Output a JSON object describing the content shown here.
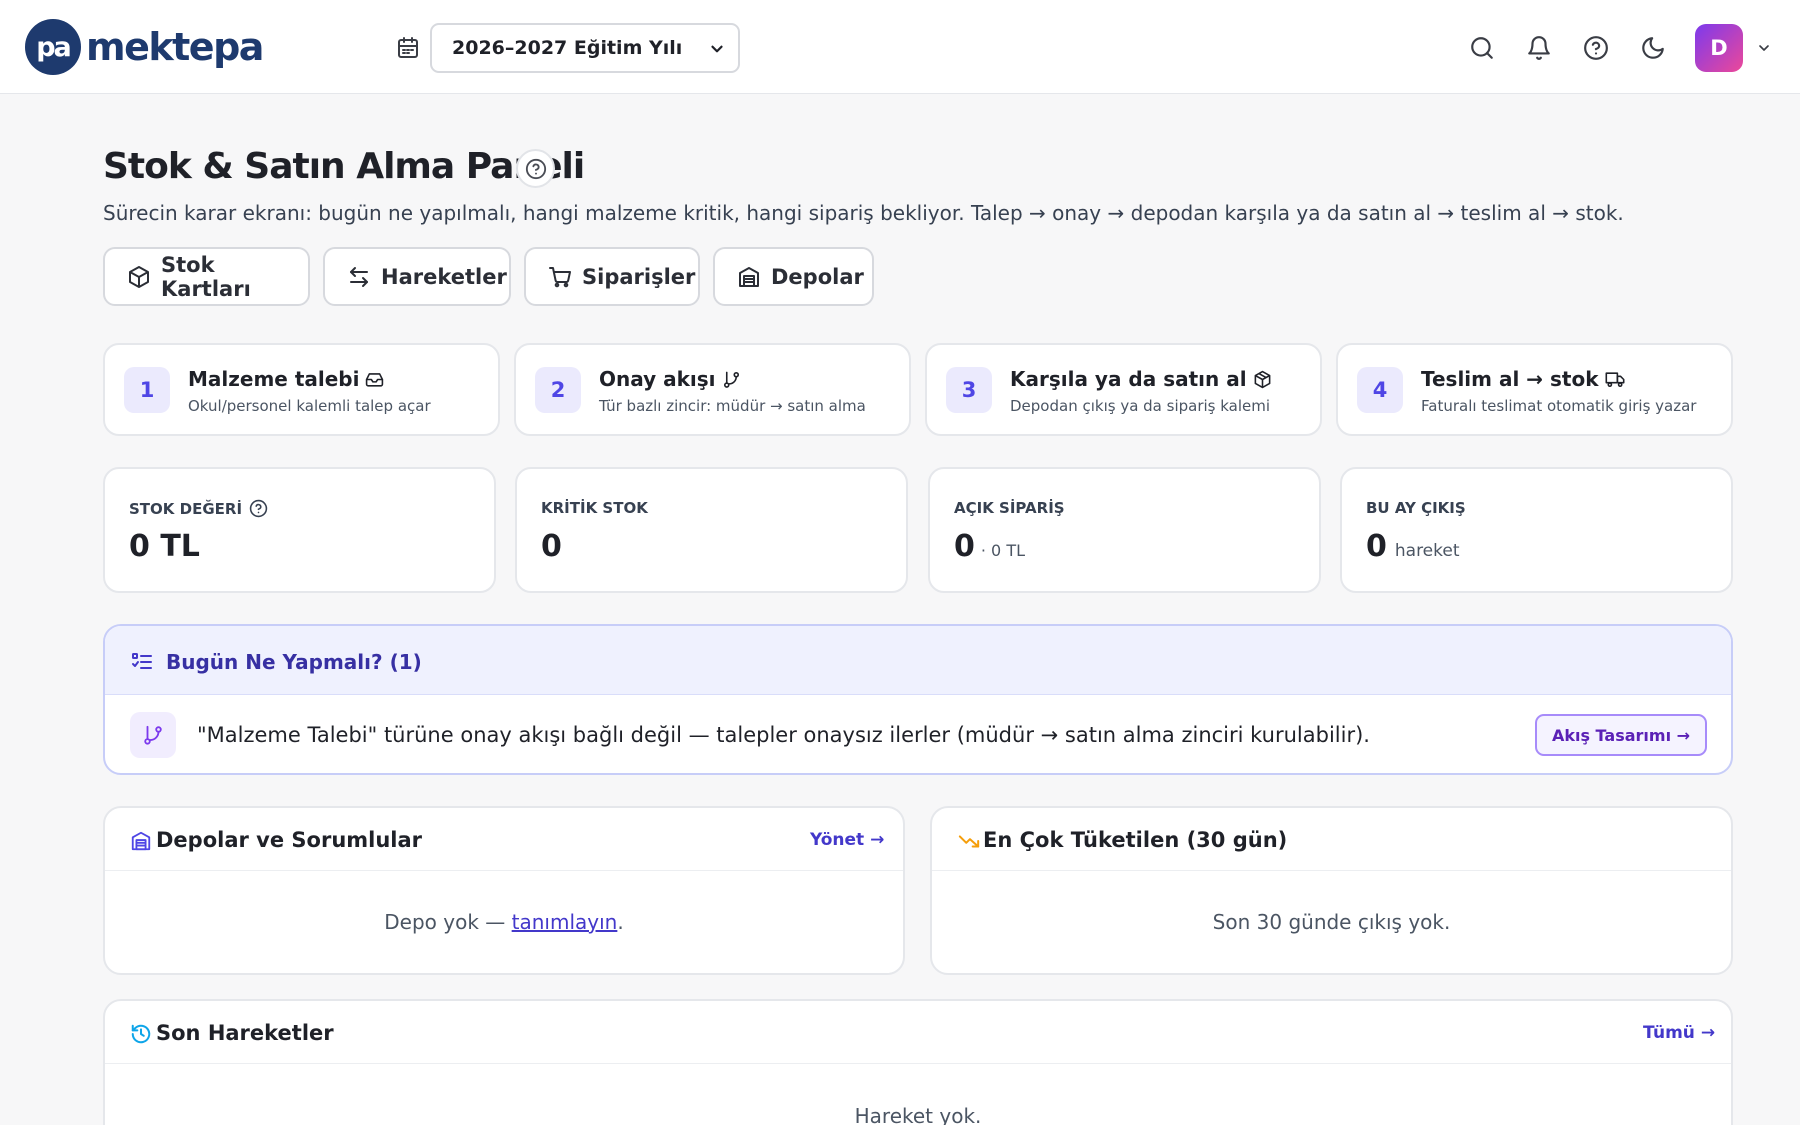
{
  "topbar": {
    "logo_mark": "pa",
    "logo_text": "mektepa",
    "year_select_value": "2026–2027 Eğitim Yılı",
    "avatar_initial": "D",
    "icons": [
      "calendar-icon",
      "search-icon",
      "bell-icon",
      "help-icon",
      "moon-icon",
      "chevron-down-icon"
    ]
  },
  "page": {
    "title": "Stok & Satın Alma Paneli",
    "subtitle": "Sürecin karar ekranı: bugün ne yapılmalı, hangi malzeme kritik, hangi sipariş bekliyor. Talep → onay → depodan karşıla ya da satın al → teslim al → stok."
  },
  "nav_buttons": [
    {
      "label": "Stok Kartları",
      "icon": "box-icon"
    },
    {
      "label": "Hareketler",
      "icon": "arrows-icon"
    },
    {
      "label": "Siparişler",
      "icon": "cart-icon"
    },
    {
      "label": "Depolar",
      "icon": "warehouse-icon"
    }
  ],
  "steps": [
    {
      "num": "1",
      "title": "Malzeme talebi",
      "desc": "Okul/personel kalemli talep açar",
      "icon": "inbox-icon"
    },
    {
      "num": "2",
      "title": "Onay akışı",
      "desc": "Tür bazlı zincir: müdür → satın alma",
      "icon": "branch-icon"
    },
    {
      "num": "3",
      "title": "Karşıla ya da satın al",
      "desc": "Depodan çıkış ya da sipariş kalemi",
      "icon": "package-icon"
    },
    {
      "num": "4",
      "title": "Teslim al → stok",
      "desc": "Faturalı teslimat otomatik giriş yazar",
      "icon": "truck-icon"
    }
  ],
  "kpis": [
    {
      "label": "STOK DEĞERİ",
      "value": "0 TL",
      "sub": ""
    },
    {
      "label": "KRİTİK STOK",
      "value": "0",
      "sub": ""
    },
    {
      "label": "AÇIK SİPARİŞ",
      "value": "0",
      "sub": "· 0 TL"
    },
    {
      "label": "BU AY ÇIKIŞ",
      "value": "0",
      "sub": "hareket"
    }
  ],
  "todo": {
    "title": "Bugün Ne Yapmalı? (1)",
    "item_text": "\"Malzeme Talebi\" türüne onay akışı bağlı değil — talepler onaysız ilerler (müdür → satın alma zinciri kurulabilir).",
    "item_button": "Akış Tasarımı →"
  },
  "warehouses": {
    "title": "Depolar ve Sorumlular",
    "link": "Yönet →",
    "empty_prefix": "Depo yok — ",
    "empty_link": "tanımlayın",
    "empty_suffix": "."
  },
  "top_consumed": {
    "title": "En Çok Tüketilen (30 gün)",
    "empty": "Son 30 günde çıkış yok."
  },
  "recent_moves": {
    "title": "Son Hareketler",
    "link": "Tümü →",
    "empty": "Hareket yok."
  }
}
